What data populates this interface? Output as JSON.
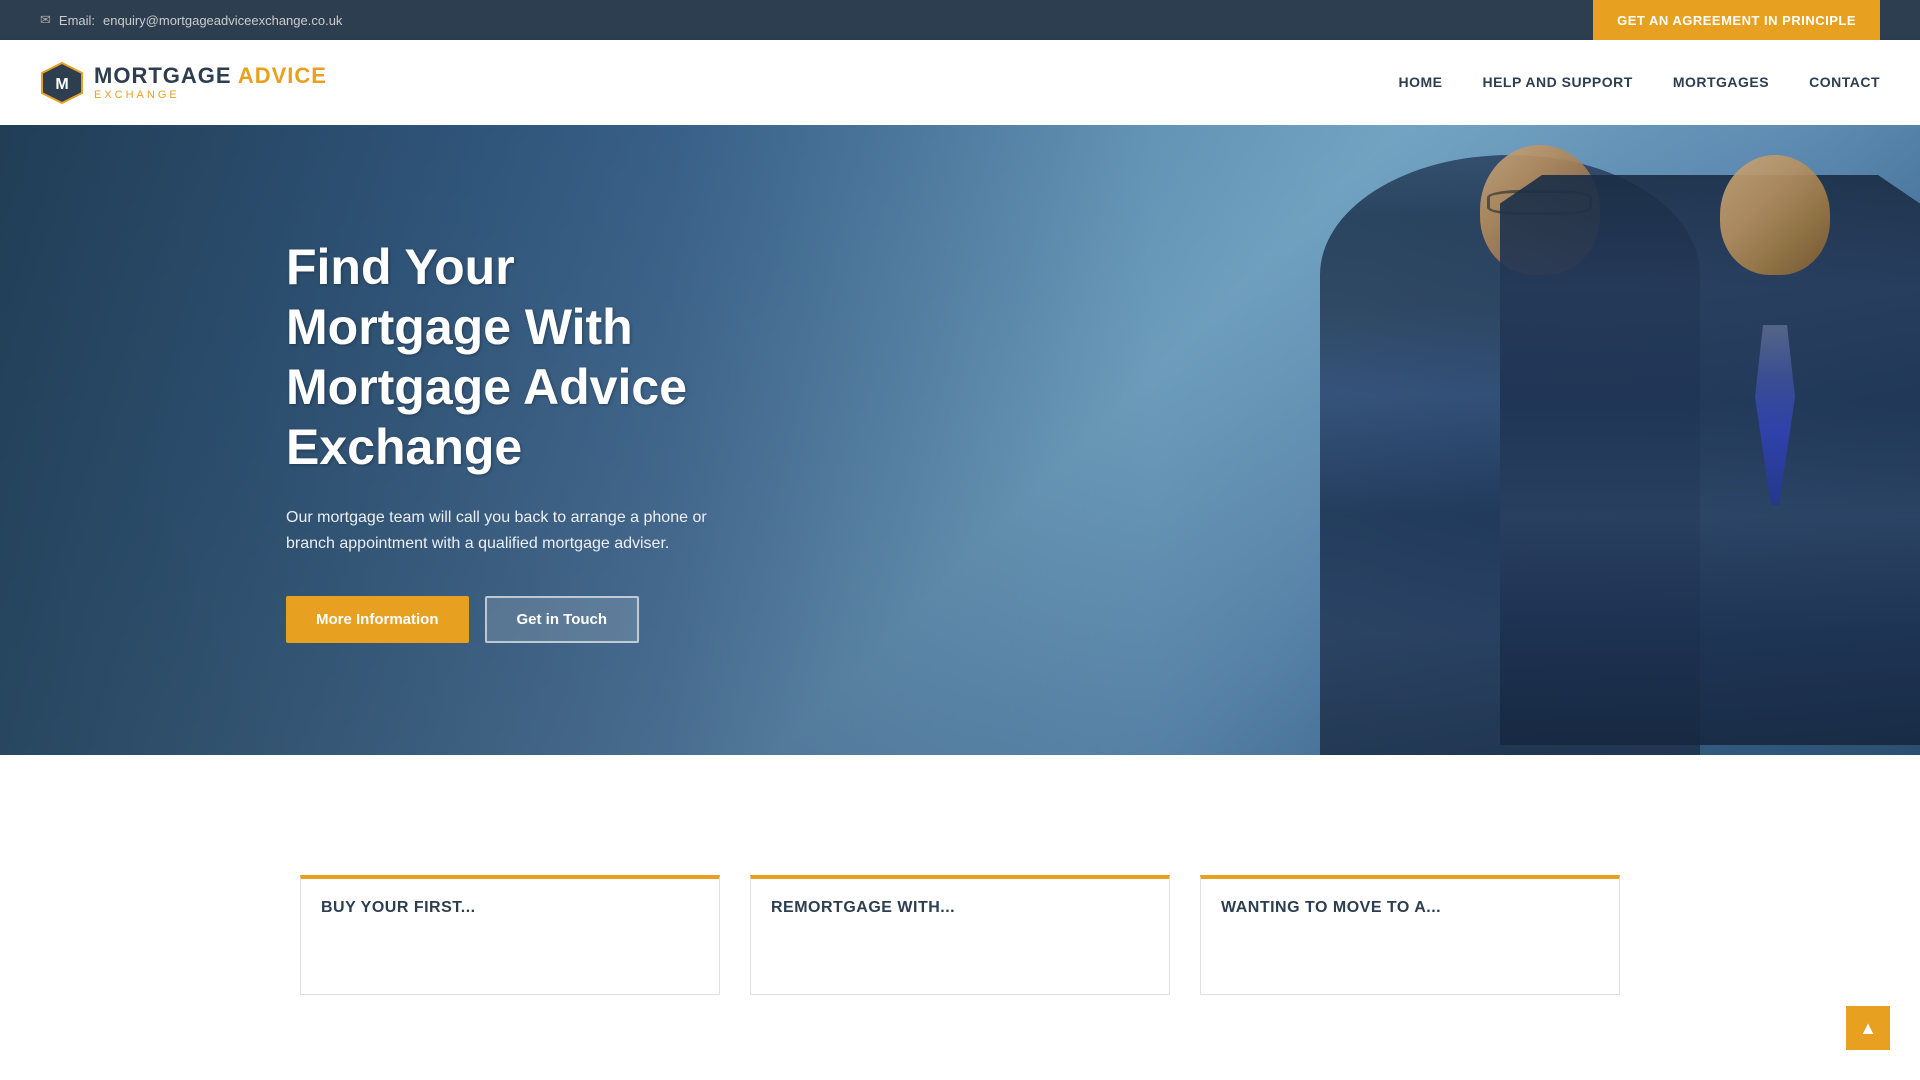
{
  "topbar": {
    "email_prefix": "Email:",
    "email": "enquiry@mortgageadviceexchange.co.uk",
    "cta_button": "GET AN AGREEMENT IN PRINCIPLE"
  },
  "navbar": {
    "logo_main_part1": "MORTGAGE ",
    "logo_main_part2": "ADVICE",
    "logo_sub": "EXCHANGE",
    "links": [
      {
        "label": "HOME",
        "id": "home"
      },
      {
        "label": "HELP AND SUPPORT",
        "id": "help-support"
      },
      {
        "label": "MORTGAGES",
        "id": "mortgages"
      },
      {
        "label": "CONTACT",
        "id": "contact"
      }
    ]
  },
  "hero": {
    "title": "Find Your Mortgage With Mortgage Advice Exchange",
    "subtitle": "Our mortgage team will call you back to arrange a phone or branch appointment with a qualified mortgage adviser.",
    "btn_more_info": "More Information",
    "btn_get_in_touch": "Get in Touch"
  },
  "cards": [
    {
      "label": "BUY YOUR FIRST..."
    },
    {
      "label": "REMORTGAGE WITH..."
    },
    {
      "label": "WANTING TO MOVE TO A..."
    }
  ],
  "scroll_top": "▲"
}
